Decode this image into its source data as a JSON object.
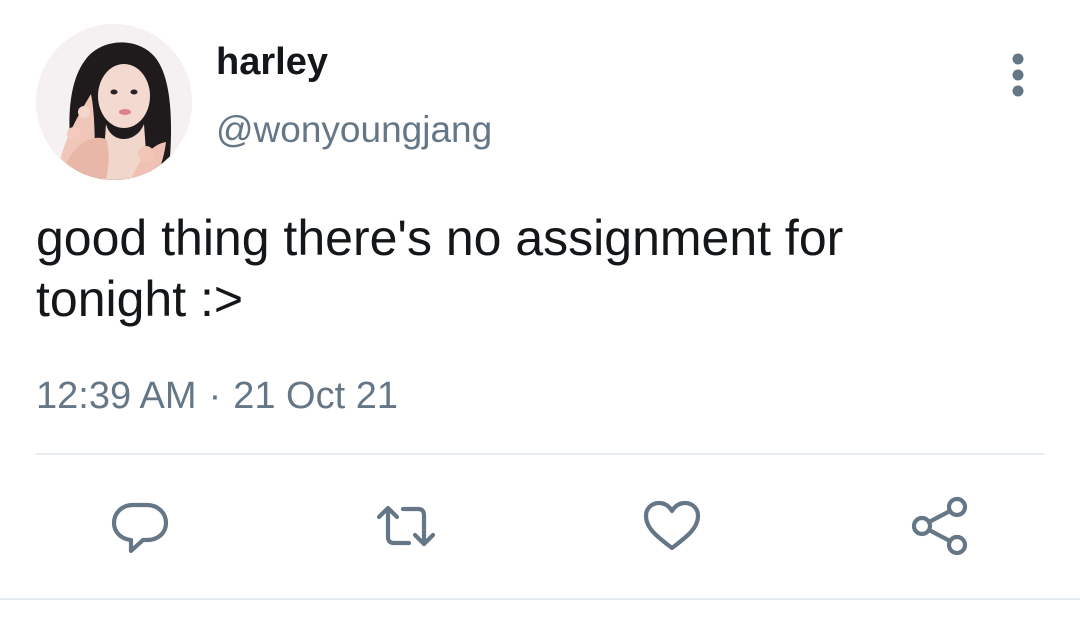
{
  "author": {
    "display_name": "harley",
    "handle": "@wonyoungjang"
  },
  "tweet": {
    "text": "good thing there's no assignment for\ntonight :>",
    "time": "12:39 AM",
    "separator": "·",
    "date": "21 Oct 21"
  },
  "actions": {
    "reply_icon": "speech-bubble",
    "retweet_icon": "retweet-arrows",
    "like_icon": "heart-outline",
    "share_icon": "share-nodes"
  },
  "colors": {
    "text": "#14171a",
    "secondary": "#657786",
    "divider": "#e6ecf0"
  }
}
